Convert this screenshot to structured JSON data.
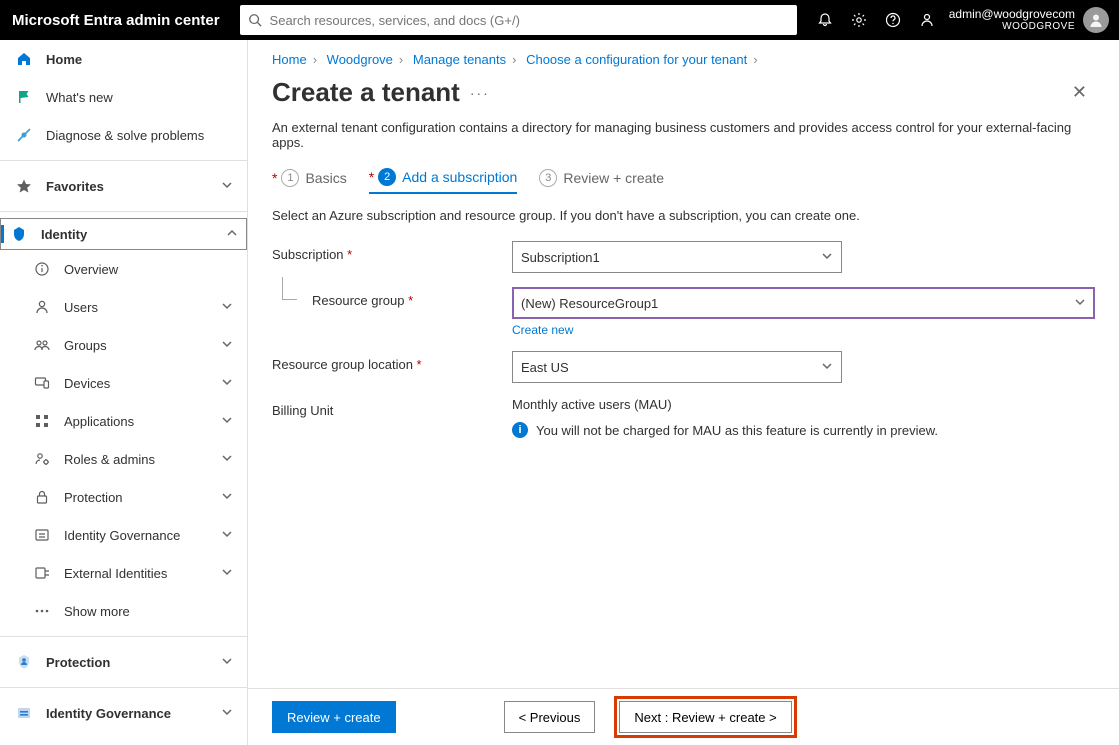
{
  "topbar": {
    "brand": "Microsoft Entra admin center",
    "search_placeholder": "Search resources, services, and docs (G+/)",
    "account_email": "admin@woodgrovecom",
    "account_tenant": "WOODGROVE"
  },
  "sidebar": {
    "home": "Home",
    "whatsnew": "What's new",
    "diagnose": "Diagnose & solve problems",
    "favorites": "Favorites",
    "identity": "Identity",
    "overview": "Overview",
    "users": "Users",
    "groups": "Groups",
    "devices": "Devices",
    "applications": "Applications",
    "roles": "Roles & admins",
    "protection_sub": "Protection",
    "idgov_sub": "Identity Governance",
    "extid": "External Identities",
    "showmore": "Show more",
    "protection": "Protection",
    "idgov": "Identity Governance"
  },
  "breadcrumbs": {
    "b1": "Home",
    "b2": "Woodgrove",
    "b3": "Manage tenants",
    "b4": "Choose a configuration for your tenant"
  },
  "page": {
    "title": "Create a tenant",
    "description": "An external tenant configuration contains a directory for managing business customers and provides access control for your external-facing apps."
  },
  "tabs": {
    "t1_num": "1",
    "t1": "Basics",
    "t2_num": "2",
    "t2": "Add a subscription",
    "t3_num": "3",
    "t3": "Review + create"
  },
  "form": {
    "hint": "Select an Azure subscription and resource group. If you don't have a subscription, you can create one.",
    "subscription_label": "Subscription",
    "subscription_value": "Subscription1",
    "rg_label": "Resource group",
    "rg_value": "(New) ResourceGroup1",
    "rg_create": "Create new",
    "loc_label": "Resource group location",
    "loc_value": "East US",
    "billing_label": "Billing Unit",
    "billing_value": "Monthly active users (MAU)",
    "billing_info": "You will not be charged for MAU as this feature is currently in preview."
  },
  "footer": {
    "review": "Review + create",
    "prev": "< Previous",
    "next": "Next : Review + create >"
  }
}
